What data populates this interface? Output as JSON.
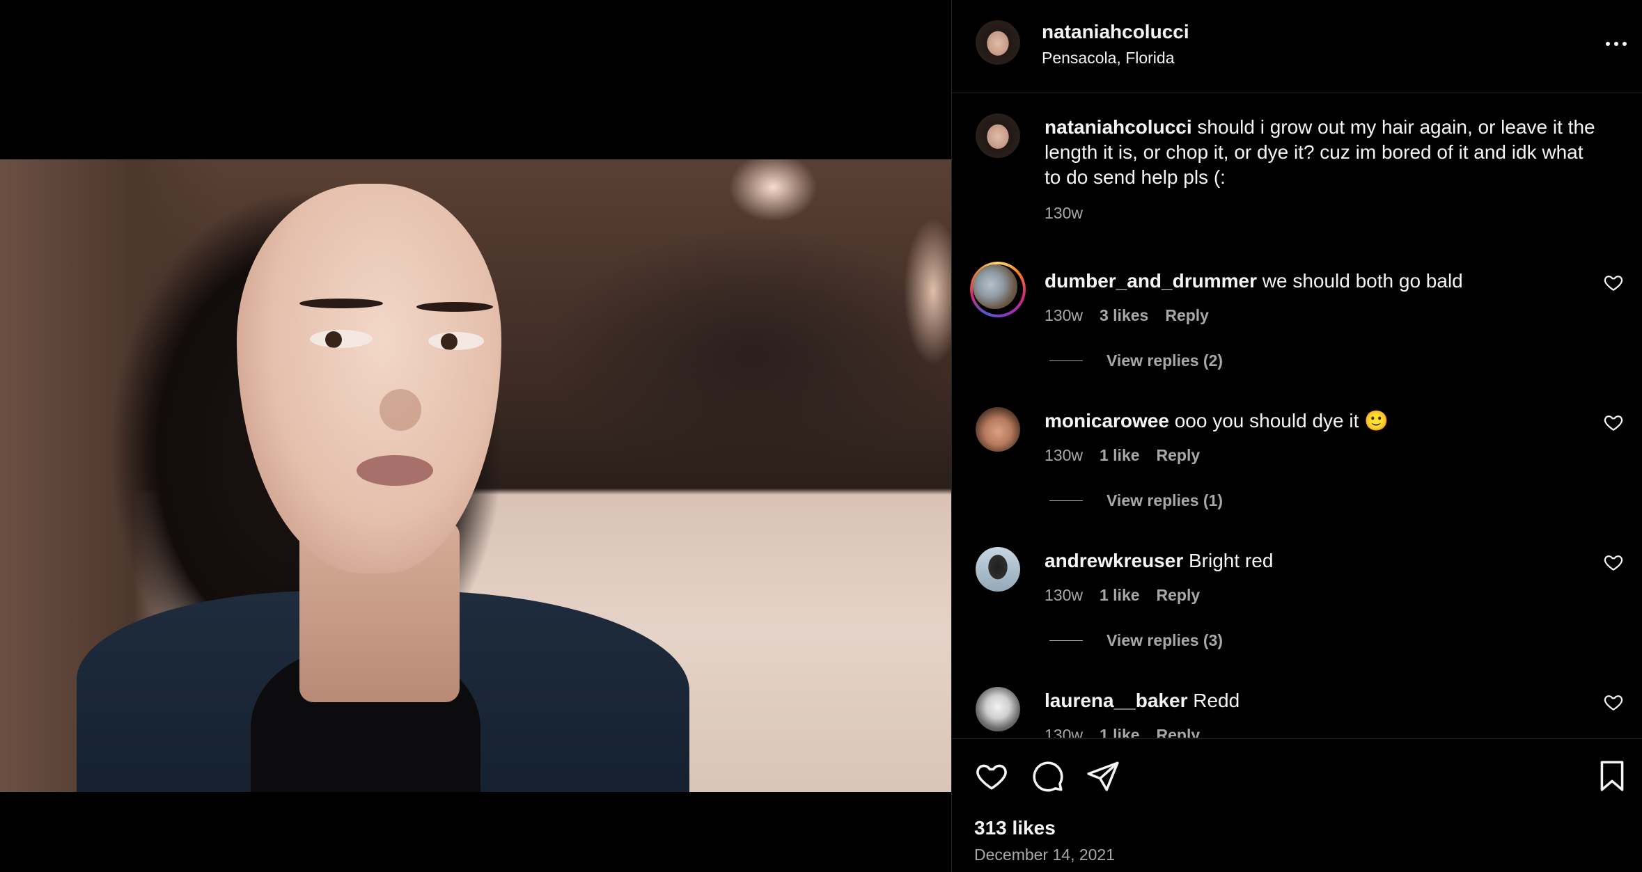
{
  "post": {
    "author": "nataniahcolucci",
    "location": "Pensacola, Florida",
    "caption": {
      "username": "nataniahcolucci",
      "text": "should i grow out my hair again, or leave it the length it is, or chop it, or dye it? cuz im bored of it and idk what to do send help pls (:",
      "time": "130w"
    },
    "likes": "313 likes",
    "date": "December 14, 2021"
  },
  "comments": [
    {
      "username": "dumber_and_drummer",
      "text": "we should both go bald",
      "time": "130w",
      "likes": "3 likes",
      "reply": "Reply",
      "view_replies": "View replies (2)",
      "has_story_ring": true
    },
    {
      "username": "monicarowee",
      "text": "ooo you should dye it 🙂",
      "time": "130w",
      "likes": "1 like",
      "reply": "Reply",
      "view_replies": "View replies (1)"
    },
    {
      "username": "andrewkreuser",
      "text": "Bright red",
      "time": "130w",
      "likes": "1 like",
      "reply": "Reply",
      "view_replies": "View replies (3)"
    },
    {
      "username": "laurena__baker",
      "text": "Redd",
      "time": "130w",
      "likes": "1 like",
      "reply": "Reply"
    }
  ],
  "icons": {
    "more": "more-horizontal-icon",
    "like": "heart-icon",
    "comment": "comment-bubble-icon",
    "share": "paper-plane-icon",
    "save": "bookmark-icon"
  },
  "colors": {
    "background": "#000000",
    "primary_text": "#f5f5f5",
    "secondary_text": "#a8a8a8",
    "divider": "#262626"
  }
}
